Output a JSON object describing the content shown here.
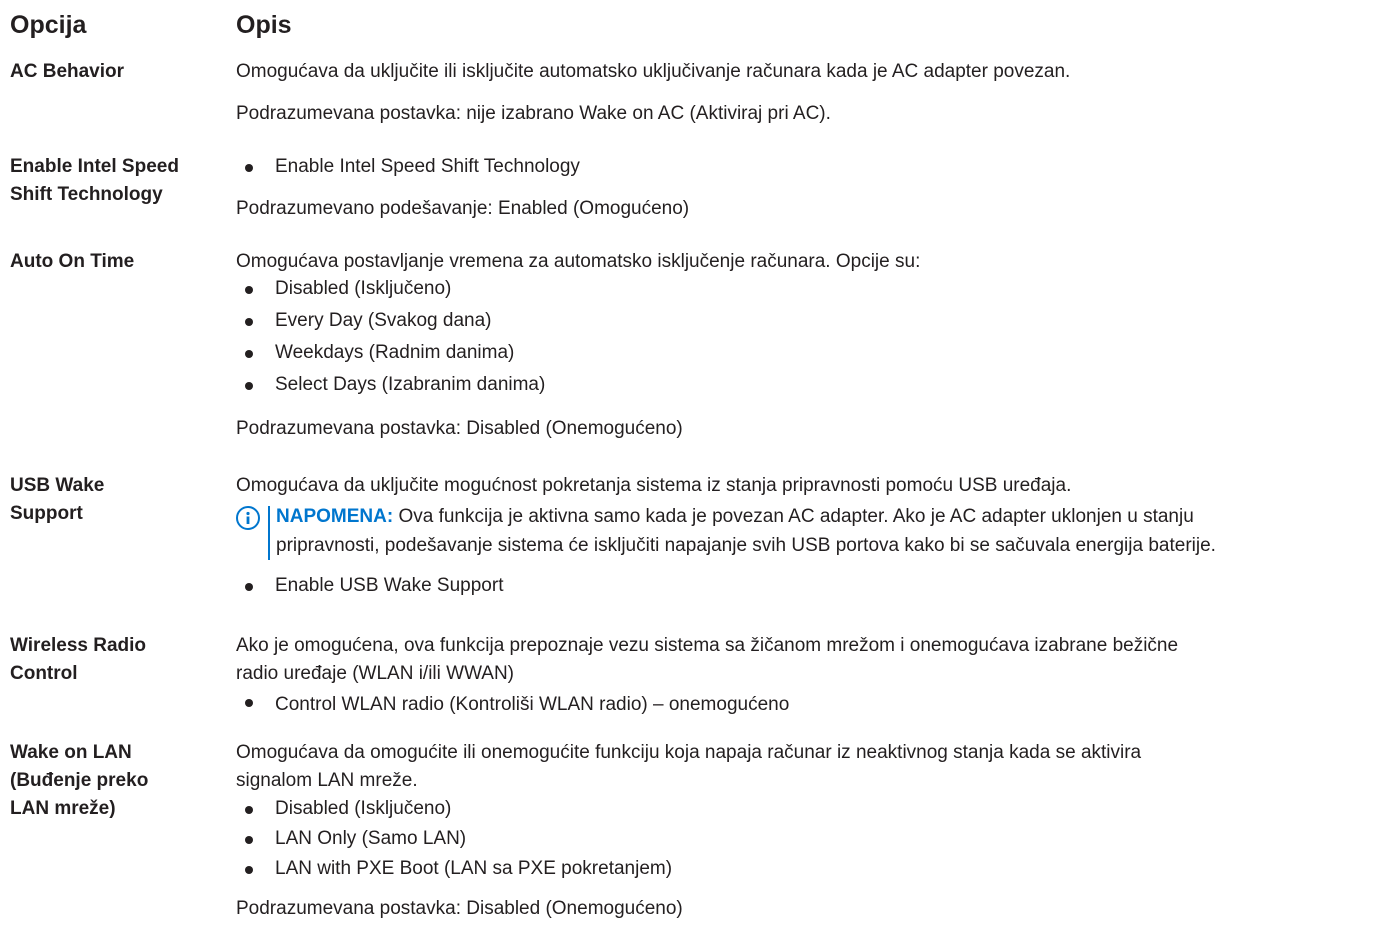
{
  "header": {
    "col1": "Opcija",
    "col2": "Opis"
  },
  "rows": [
    {
      "label": "AC Behavior",
      "desc1": "Omogućava da uključite ili isključite automatsko uključivanje računara kada je AC adapter povezan.",
      "desc2": "Podrazumevana postavka: nije izabrano Wake on AC (Aktiviraj pri AC)."
    },
    {
      "label_line1": "Enable Intel Speed",
      "label_line2": "Shift Technology",
      "bullets": [
        "Enable Intel Speed Shift Technology"
      ],
      "desc2": "Podrazumevano podešavanje: Enabled (Omogućeno)"
    },
    {
      "label": "Auto On Time",
      "desc1": "Omogućava postavljanje vremena za automatsko isključenje računara. Opcije su:",
      "bullets": [
        "Disabled (Isključeno)",
        "Every Day (Svakog dana)",
        "Weekdays (Radnim danima)",
        "Select Days (Izabranim danima)"
      ],
      "desc2": "Podrazumevana postavka: Disabled (Onemogućeno)"
    },
    {
      "label_line1": "USB Wake",
      "label_line2": "Support",
      "desc1": "Omogućava da uključite mogućnost pokretanja sistema iz stanja pripravnosti pomoću USB uređaja.",
      "note_label": "NAPOMENA:",
      "note_line1": " Ova funkcija je aktivna samo kada je povezan AC adapter. Ako je AC adapter uklonjen u stanju",
      "note_line2": "pripravnosti, podešavanje sistema će isključiti napajanje svih USB portova kako bi se sačuvala energija baterije.",
      "bullets": [
        "Enable USB Wake Support"
      ]
    },
    {
      "label_line1": "Wireless Radio",
      "label_line2": "Control",
      "desc1": "Ako je omogućena, ova funkcija prepoznaje vezu sistema sa žičanom mrežom i onemogućava izabrane bežične",
      "desc1b": "radio uređaje (WLAN i/ili WWAN)",
      "bullets": [
        "Control WLAN radio (Kontroliši WLAN radio) – onemogućeno"
      ]
    },
    {
      "label_line1": "Wake on LAN",
      "label_line2": "(Buđenje preko",
      "label_line3": "LAN mreže)",
      "desc1": "Omogućava da omogućite ili onemogućite funkciju koja napaja računar iz neaktivnog stanja kada se aktivira",
      "desc1b": "signalom LAN mreže.",
      "bullets": [
        "Disabled (Isključeno)",
        "LAN Only (Samo LAN)",
        "LAN with PXE Boot (LAN sa PXE pokretanjem)"
      ],
      "desc2": "Podrazumevana postavka: Disabled (Onemogućeno)"
    }
  ]
}
